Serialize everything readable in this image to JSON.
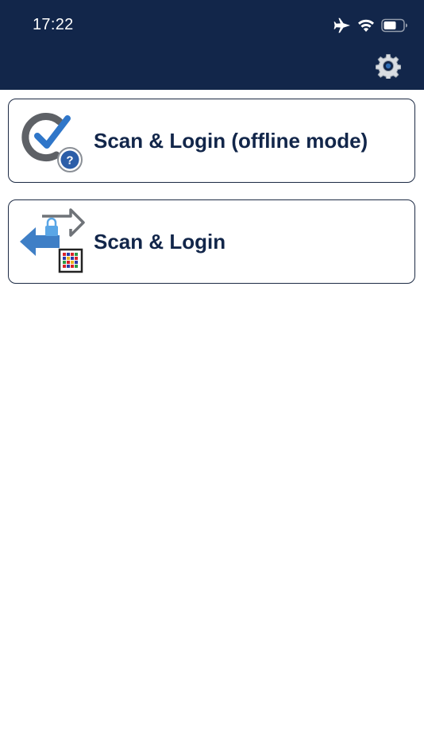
{
  "status_bar": {
    "time": "17:22",
    "icons": [
      "airplane-icon",
      "wifi-icon",
      "battery-icon"
    ]
  },
  "header": {
    "background": "#12264a",
    "settings_icon": "gear-icon"
  },
  "menu": {
    "items": [
      {
        "label": "Scan & Login (offline mode)",
        "icon": "offline-check-icon"
      },
      {
        "label": "Scan & Login",
        "icon": "login-arrows-icon"
      }
    ]
  },
  "colors": {
    "accent": "#12264a",
    "card_border": "#1c2a44",
    "check_blue": "#2f76c9"
  }
}
